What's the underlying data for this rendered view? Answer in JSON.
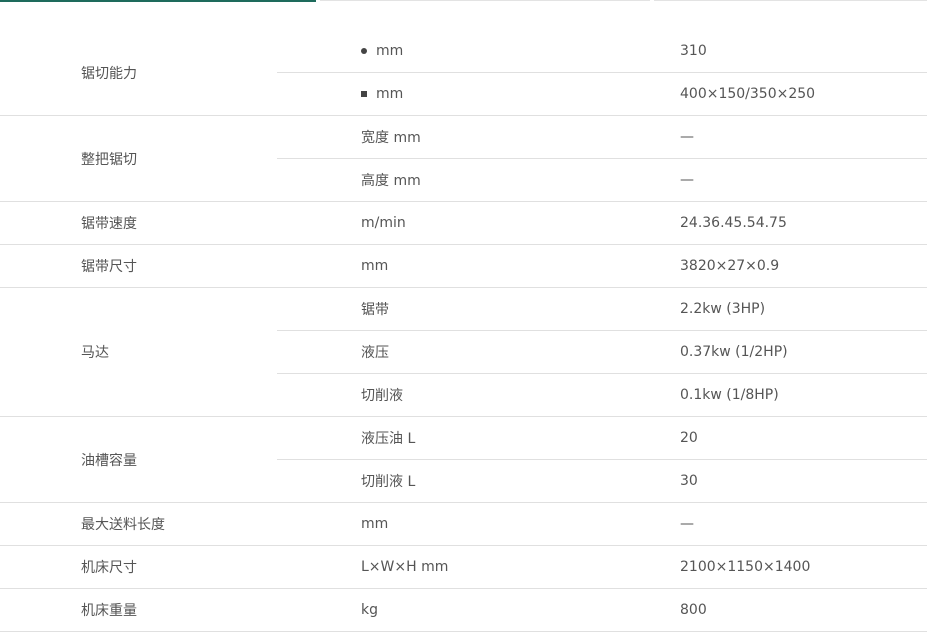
{
  "specs": [
    {
      "name": "锯切能力",
      "rows": [
        {
          "icon": "round-stock-icon",
          "unit": "mm",
          "value": "310"
        },
        {
          "icon": "square-stock-icon",
          "unit": "mm",
          "value": "400×150/350×250"
        }
      ]
    },
    {
      "name": "整把锯切",
      "rows": [
        {
          "unit": "宽度 mm",
          "value": "—"
        },
        {
          "unit": "高度 mm",
          "value": "—"
        }
      ]
    },
    {
      "name": "锯带速度",
      "rows": [
        {
          "unit": "m/min",
          "value": "24.36.45.54.75"
        }
      ]
    },
    {
      "name": "锯带尺寸",
      "rows": [
        {
          "unit": "mm",
          "value": "3820×27×0.9"
        }
      ]
    },
    {
      "name": "马达",
      "rows": [
        {
          "unit": "锯带",
          "value": "2.2kw  (3HP)"
        },
        {
          "unit": "液压",
          "value": "0.37kw (1/2HP)"
        },
        {
          "unit": "切削液",
          "value": "0.1kw  (1/8HP)"
        }
      ]
    },
    {
      "name": "油槽容量",
      "rows": [
        {
          "unit": "液压油 L",
          "value": "20"
        },
        {
          "unit": "切削液 L",
          "value": "30"
        }
      ]
    },
    {
      "name": "最大送料长度",
      "rows": [
        {
          "unit": "mm",
          "value": "—"
        }
      ]
    },
    {
      "name": "机床尺寸",
      "rows": [
        {
          "unit": "L×W×H mm",
          "value": "2100×1150×1400"
        }
      ]
    },
    {
      "name": "机床重量",
      "rows": [
        {
          "unit": "kg",
          "value": "800"
        }
      ]
    }
  ]
}
